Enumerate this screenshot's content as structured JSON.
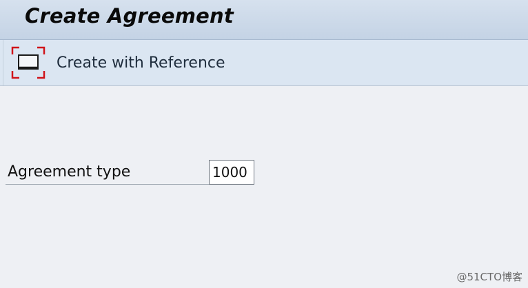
{
  "header": {
    "title": "Create Agreement"
  },
  "toolbar": {
    "create_with_reference": {
      "label": "Create with Reference",
      "icon": "create-with-reference-icon"
    }
  },
  "form": {
    "agreement_type": {
      "label": "Agreement type",
      "value": "1000"
    }
  },
  "watermark": "@51CTO博客",
  "colors": {
    "title_bar": "#c4d3e5",
    "toolbar": "#dbe6f2",
    "background": "#eef0f4",
    "icon_corner_accent": "#d0141a"
  }
}
